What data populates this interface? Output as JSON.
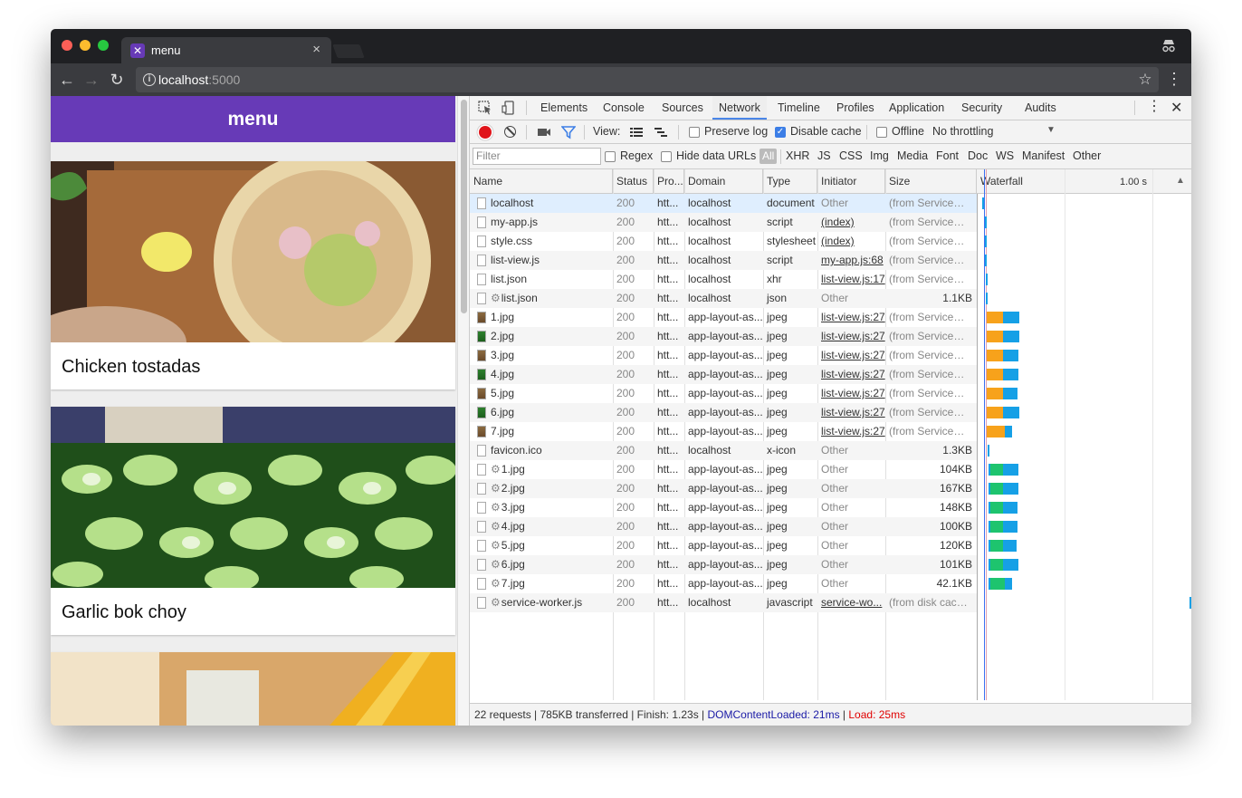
{
  "browser": {
    "tab_title": "menu",
    "url_host": "localhost",
    "url_port": ":5000"
  },
  "app": {
    "title": "menu",
    "cards": [
      {
        "title": "Chicken tostadas"
      },
      {
        "title": "Garlic bok choy"
      },
      {
        "title": ""
      }
    ]
  },
  "devtools": {
    "tabs": [
      "Elements",
      "Console",
      "Sources",
      "Network",
      "Timeline",
      "Profiles",
      "Application",
      "Security",
      "Audits"
    ],
    "active_tab": "Network",
    "view_label": "View:",
    "preserve_log": "Preserve log",
    "disable_cache": "Disable cache",
    "offline": "Offline",
    "throttling": "No throttling",
    "filter_placeholder": "Filter",
    "regex": "Regex",
    "hide_data_urls": "Hide data URLs",
    "types": [
      "All",
      "XHR",
      "JS",
      "CSS",
      "Img",
      "Media",
      "Font",
      "Doc",
      "WS",
      "Manifest",
      "Other"
    ],
    "columns": [
      "Name",
      "Status",
      "Pro...",
      "Domain",
      "Type",
      "Initiator",
      "Size",
      "Waterfall"
    ],
    "waterfall_time": "1.00 s",
    "requests": [
      {
        "name": "localhost",
        "status": "200",
        "proto": "htt...",
        "domain": "localhost",
        "type": "document",
        "initiator": "Other",
        "size": "(from ServiceWo..."
      },
      {
        "name": "my-app.js",
        "status": "200",
        "proto": "htt...",
        "domain": "localhost",
        "type": "script",
        "initiator": "(index)",
        "size": "(from ServiceWo..."
      },
      {
        "name": "style.css",
        "status": "200",
        "proto": "htt...",
        "domain": "localhost",
        "type": "stylesheet",
        "initiator": "(index)",
        "size": "(from ServiceWo..."
      },
      {
        "name": "list-view.js",
        "status": "200",
        "proto": "htt...",
        "domain": "localhost",
        "type": "script",
        "initiator": "my-app.js:68",
        "size": "(from ServiceWo..."
      },
      {
        "name": "list.json",
        "status": "200",
        "proto": "htt...",
        "domain": "localhost",
        "type": "xhr",
        "initiator": "list-view.js:17",
        "size": "(from ServiceWo..."
      },
      {
        "name": "list.json",
        "status": "200",
        "proto": "htt...",
        "domain": "localhost",
        "type": "json",
        "initiator": "Other",
        "size": "1.1KB"
      },
      {
        "name": "1.jpg",
        "status": "200",
        "proto": "htt...",
        "domain": "app-layout-as...",
        "type": "jpeg",
        "initiator": "list-view.js:27",
        "size": "(from ServiceWo..."
      },
      {
        "name": "2.jpg",
        "status": "200",
        "proto": "htt...",
        "domain": "app-layout-as...",
        "type": "jpeg",
        "initiator": "list-view.js:27",
        "size": "(from ServiceWo..."
      },
      {
        "name": "3.jpg",
        "status": "200",
        "proto": "htt...",
        "domain": "app-layout-as...",
        "type": "jpeg",
        "initiator": "list-view.js:27",
        "size": "(from ServiceWo..."
      },
      {
        "name": "4.jpg",
        "status": "200",
        "proto": "htt...",
        "domain": "app-layout-as...",
        "type": "jpeg",
        "initiator": "list-view.js:27",
        "size": "(from ServiceWo..."
      },
      {
        "name": "5.jpg",
        "status": "200",
        "proto": "htt...",
        "domain": "app-layout-as...",
        "type": "jpeg",
        "initiator": "list-view.js:27",
        "size": "(from ServiceWo..."
      },
      {
        "name": "6.jpg",
        "status": "200",
        "proto": "htt...",
        "domain": "app-layout-as...",
        "type": "jpeg",
        "initiator": "list-view.js:27",
        "size": "(from ServiceWo..."
      },
      {
        "name": "7.jpg",
        "status": "200",
        "proto": "htt...",
        "domain": "app-layout-as...",
        "type": "jpeg",
        "initiator": "list-view.js:27",
        "size": "(from ServiceWo..."
      },
      {
        "name": "favicon.ico",
        "status": "200",
        "proto": "htt...",
        "domain": "localhost",
        "type": "x-icon",
        "initiator": "Other",
        "size": "1.3KB"
      },
      {
        "name": "1.jpg",
        "status": "200",
        "proto": "htt...",
        "domain": "app-layout-as...",
        "type": "jpeg",
        "initiator": "Other",
        "size": "104KB"
      },
      {
        "name": "2.jpg",
        "status": "200",
        "proto": "htt...",
        "domain": "app-layout-as...",
        "type": "jpeg",
        "initiator": "Other",
        "size": "167KB"
      },
      {
        "name": "3.jpg",
        "status": "200",
        "proto": "htt...",
        "domain": "app-layout-as...",
        "type": "jpeg",
        "initiator": "Other",
        "size": "148KB"
      },
      {
        "name": "4.jpg",
        "status": "200",
        "proto": "htt...",
        "domain": "app-layout-as...",
        "type": "jpeg",
        "initiator": "Other",
        "size": "100KB"
      },
      {
        "name": "5.jpg",
        "status": "200",
        "proto": "htt...",
        "domain": "app-layout-as...",
        "type": "jpeg",
        "initiator": "Other",
        "size": "120KB"
      },
      {
        "name": "6.jpg",
        "status": "200",
        "proto": "htt...",
        "domain": "app-layout-as...",
        "type": "jpeg",
        "initiator": "Other",
        "size": "101KB"
      },
      {
        "name": "7.jpg",
        "status": "200",
        "proto": "htt...",
        "domain": "app-layout-as...",
        "type": "jpeg",
        "initiator": "Other",
        "size": "42.1KB"
      },
      {
        "name": "service-worker.js",
        "status": "200",
        "proto": "htt...",
        "domain": "localhost",
        "type": "javascript",
        "initiator": "service-wo...",
        "size": "(from disk cache)"
      }
    ],
    "status": {
      "summary": "22 requests | 785KB transferred | Finish: 1.23s | ",
      "dcl": "DOMContentLoaded: 21ms",
      "sep": " | ",
      "load": "Load: 25ms"
    },
    "colors": {
      "dcl": "#1a1aa6",
      "load": "#e00000",
      "waiting": "#f7a21b",
      "download_sw": "#16a0e6",
      "download_net": "#1ec46e"
    }
  }
}
